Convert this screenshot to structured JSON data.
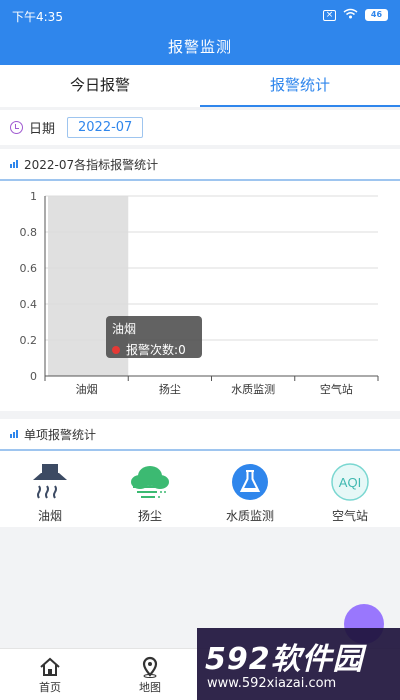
{
  "status": {
    "time": "下午4:35",
    "battery": "46"
  },
  "header": {
    "title": "报警监测"
  },
  "tabs": [
    {
      "label": "今日报警"
    },
    {
      "label": "报警统计"
    }
  ],
  "date_filter": {
    "label": "日期",
    "value": "2022-07"
  },
  "chart_card": {
    "title": "2022-07各指标报警统计"
  },
  "chart_data": {
    "type": "bar",
    "categories": [
      "油烟",
      "扬尘",
      "水质监测",
      "空气站"
    ],
    "series": [
      {
        "name": "报警次数",
        "values": [
          0,
          0,
          0,
          0
        ]
      }
    ],
    "ylim": [
      0,
      1
    ],
    "yticks": [
      "0",
      "0.2",
      "0.4",
      "0.6",
      "0.8",
      "1"
    ],
    "highlighted_category": "油烟",
    "grid": true,
    "tooltip": {
      "title": "油烟",
      "series": "报警次数",
      "value": "0"
    }
  },
  "colors": {
    "accent": "#2f86ec",
    "tooltip_dot": "#e53935",
    "highlight": "#e0e0e0"
  },
  "single_stats": {
    "title": "单项报警统计",
    "items": [
      {
        "label": "油烟",
        "icon": "range-hood-icon"
      },
      {
        "label": "扬尘",
        "icon": "dust-cloud-icon"
      },
      {
        "label": "水质监测",
        "icon": "flask-icon"
      },
      {
        "label": "空气站",
        "icon": "aqi-icon"
      }
    ]
  },
  "bottom_nav": [
    {
      "label": "首页",
      "icon": "home-icon"
    },
    {
      "label": "地图",
      "icon": "map-pin-icon"
    }
  ],
  "watermark": {
    "brand": "592软件园",
    "url": "www.592xiazai.com"
  }
}
